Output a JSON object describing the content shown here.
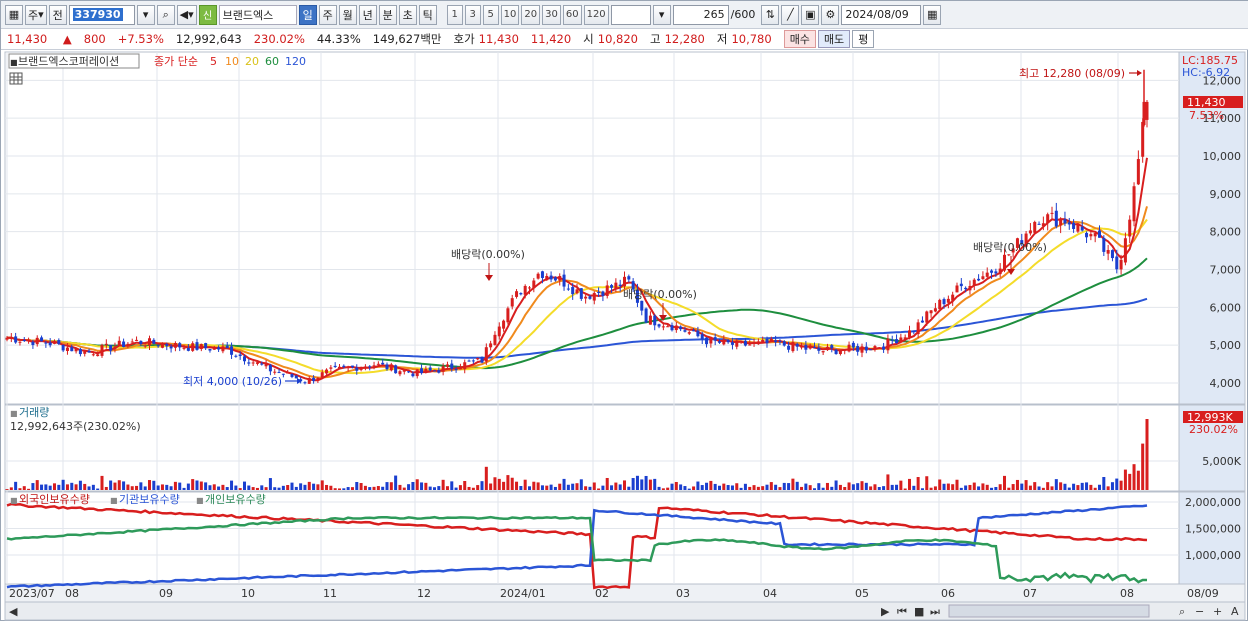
{
  "toolbar": {
    "mode": "주",
    "prev": "전",
    "code": "337930",
    "badge": "신",
    "stock_name": "브랜드엑스",
    "periods": [
      "일",
      "주",
      "월",
      "년",
      "분",
      "초",
      "틱"
    ],
    "active_period": "일",
    "intervals": [
      "1",
      "3",
      "5",
      "10",
      "20",
      "30",
      "60",
      "120"
    ],
    "count": "265",
    "total": "/600",
    "date": "2024/08/09"
  },
  "quote": {
    "price": "11,430",
    "change": "800",
    "change_pct": "+7.53%",
    "volume": "12,992,643",
    "volume_pct": "230.02%",
    "turnover": "44.33%",
    "amount": "149,627백만",
    "ask_label": "호가",
    "ask": "11,430",
    "bid": "11,420",
    "open_label": "시",
    "open": "10,820",
    "high_label": "고",
    "high": "12,280",
    "low_label": "저",
    "low": "10,780",
    "buy": "매수",
    "sell": "매도",
    "eval": "평"
  },
  "price_panel": {
    "stock_label": "브랜드엑스코퍼레이션",
    "ma_label": "종가 단순",
    "ma_periods": [
      "5",
      "10",
      "20",
      "60",
      "120"
    ],
    "lc": "LC:185.75",
    "hc": "HC:-6.92",
    "last_price": "11,430",
    "last_pct": "7.53%",
    "annotations": {
      "high": "최고 12,280 (08/09)",
      "low": "최저 4,000 (10/26)",
      "div1": "배당락(0.00%)",
      "div2": "배당락(0.00%)",
      "div3": "배당락(0.00%)"
    },
    "y_ticks": [
      "12,000",
      "11,000",
      "10,000",
      "9,000",
      "8,000",
      "7,000",
      "6,000",
      "5,000",
      "4,000"
    ]
  },
  "volume_panel": {
    "title": "거래량",
    "info": "12,992,643주(230.02%)",
    "last": "12,993K",
    "last_pct": "230.02%",
    "y_ticks": [
      "5,000K"
    ]
  },
  "holding_panel": {
    "legend": [
      "외국인보유수량",
      "기관보유수량",
      "개인보유수량"
    ],
    "y_ticks": [
      "2,000,000",
      "1,500,000",
      "1,000,000"
    ]
  },
  "x_axis": {
    "labels": [
      "2023/07",
      "08",
      "09",
      "10",
      "11",
      "12",
      "2024/01",
      "02",
      "03",
      "04",
      "05",
      "06",
      "07",
      "08"
    ],
    "right_label": "08/09"
  },
  "colors": {
    "ma5": "#d81e1e",
    "ma10": "#f08a1d",
    "ma20": "#f4dc2a",
    "ma60": "#1e8e3e",
    "ma120": "#2b55d6",
    "up": "#d81e1e",
    "down": "#1a3fcf",
    "foreign": "#d81e1e",
    "institution": "#2b55d6",
    "individual": "#2e9a5a"
  }
}
